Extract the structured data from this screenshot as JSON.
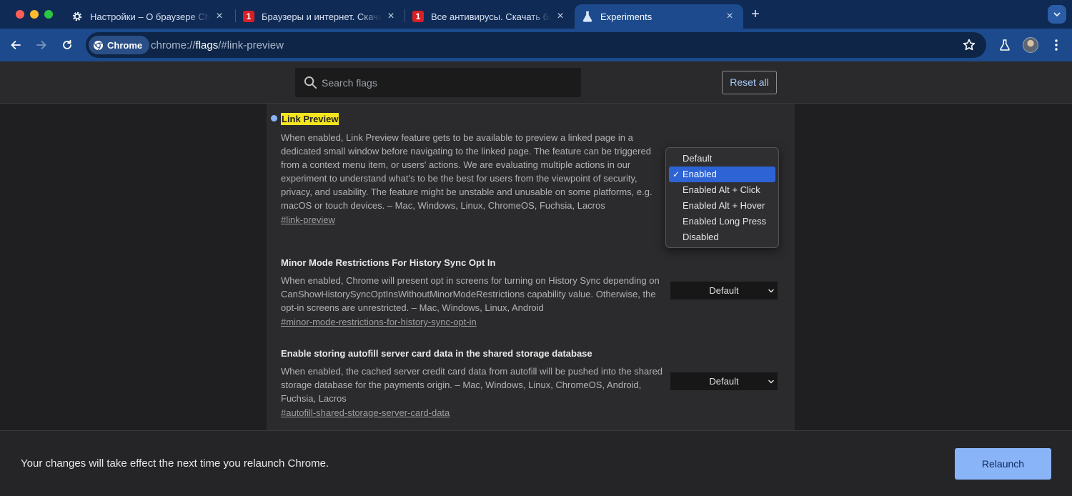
{
  "tabs": [
    {
      "title": "Настройки – О браузере Chrome",
      "icon": "gear-icon",
      "active": false
    },
    {
      "title": "Браузеры и интернет. Скачать",
      "icon": "site-favicon-icon",
      "favicon_glyph": "1",
      "active": false
    },
    {
      "title": "Все антивирусы. Скачать бесплатно",
      "icon": "site-favicon-icon",
      "favicon_glyph": "1",
      "active": false
    },
    {
      "title": "Experiments",
      "icon": "flask-icon",
      "active": true
    }
  ],
  "tab_close_glyph": "×",
  "new_tab_glyph": "+",
  "omnibox": {
    "chip_label": "Chrome",
    "url_prefix": "chrome://",
    "url_host": "flags",
    "url_path": "/#link-preview"
  },
  "search": {
    "placeholder": "Search flags",
    "value": ""
  },
  "reset_all_label": "Reset all",
  "flags": [
    {
      "id": "link-preview",
      "title": "Link Preview",
      "description": "When enabled, Link Preview feature gets to be available to preview a linked page in a dedicated small window before navigating to the linked page. The feature can be triggered from a context menu item, or users' actions. We are evaluating multiple actions in our experiment to understand what's to be the best for users from the viewpoint of security, privacy, and usability. The feature might be unstable and unusable on some platforms, e.g. macOS or touch devices. – Mac, Windows, Linux, ChromeOS, Fuchsia, Lacros",
      "link": "#link-preview",
      "highlighted": true,
      "modified": true
    },
    {
      "id": "minor-mode-restrictions-for-history-sync-opt-in",
      "title": "Minor Mode Restrictions For History Sync Opt In",
      "description": "When enabled, Chrome will present opt in screens for turning on History Sync depending on CanShowHistorySyncOptInsWithoutMinorModeRestrictions capability value. Otherwise, the opt-in screens are unrestricted. – Mac, Windows, Linux, Android",
      "link": "#minor-mode-restrictions-for-history-sync-opt-in",
      "selected": "Default"
    },
    {
      "id": "autofill-shared-storage-server-card-data",
      "title": "Enable storing autofill server card data in the shared storage database",
      "description": "When enabled, the cached server credit card data from autofill will be pushed into the shared storage database for the payments origin. – Mac, Windows, Linux, ChromeOS, Android, Fuchsia, Lacros",
      "link": "#autofill-shared-storage-server-card-data",
      "selected": "Default"
    }
  ],
  "dropdown": {
    "options": [
      "Default",
      "Enabled",
      "Enabled Alt + Click",
      "Enabled Alt + Hover",
      "Enabled Long Press",
      "Disabled"
    ],
    "selected": "Enabled",
    "check_glyph": "✓"
  },
  "bottom_bar": {
    "message": "Your changes will take effect the next time you relaunch Chrome.",
    "relaunch_label": "Relaunch"
  },
  "colors": {
    "accent": "#8ab4f8",
    "highlight": "#f5e51e",
    "toolbar": "#1c4a8c",
    "tabstrip": "#0f2a55",
    "dropdown_selected": "#2d63d4"
  }
}
